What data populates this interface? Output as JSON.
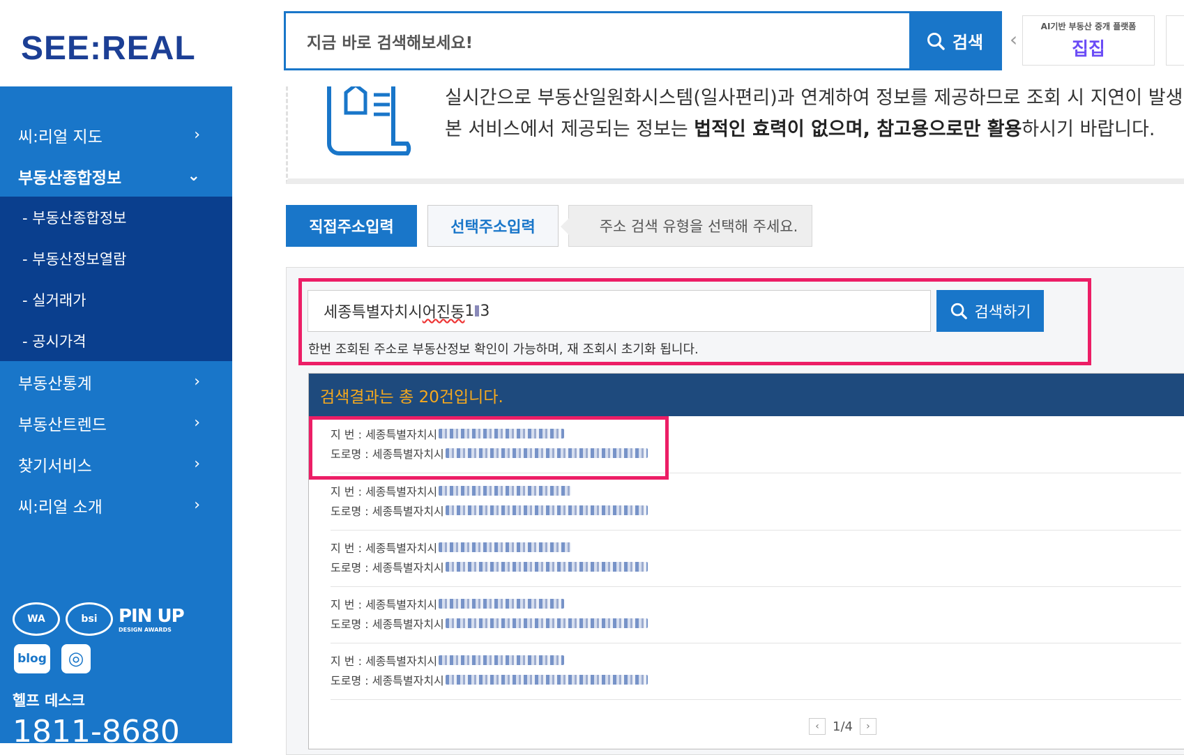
{
  "header": {
    "logo_left": "SEE",
    "logo_colon": ":",
    "logo_right": "REAL",
    "search_placeholder": "지금 바로 검색해보세요!",
    "search_button": "검색",
    "banner_small": "AI기반 부동산 중개 플랫폼",
    "banner_brand": "집집"
  },
  "sidebar": {
    "items": [
      {
        "label": "씨:리얼 지도"
      },
      {
        "label": "부동산종합정보"
      },
      {
        "label": "부동산통계"
      },
      {
        "label": "부동산트렌드"
      },
      {
        "label": "찾기서비스"
      },
      {
        "label": "씨:리얼 소개"
      }
    ],
    "submenu": [
      {
        "label": "- 부동산종합정보"
      },
      {
        "label": "- 부동산정보열람"
      },
      {
        "label": "- 실거래가"
      },
      {
        "label": "- 공시가격"
      }
    ],
    "pinup": "PIN UP",
    "pinup_sub": "DESIGN AWARDS",
    "blog": "blog",
    "help_label": "헬프 데스크",
    "help_phone": "1811-8680"
  },
  "notice": {
    "line1": "실시간으로 부동산일원화시스템(일사편리)과 연계하여 정보를 제공하므로 조회 시 지연이 발생",
    "line2_a": "본 서비스에서 제공되는 정보는 ",
    "line2_b": "법적인 효력이 없으며, 참고용으로만 활용",
    "line2_c": "하시기 바랍니다."
  },
  "tabs": {
    "direct": "직접주소입력",
    "select": "선택주소입력",
    "hint": "주소 검색 유형을 선택해 주세요."
  },
  "address_search": {
    "value_a": "세종특별자치시 ",
    "value_b": "어진동",
    "value_c": " 1",
    "value_d": "3",
    "button": "검색하기",
    "note": "한번 조회된 주소로 부동산정보 확인이 가능하며, 재 조회시 초기화 됩니다."
  },
  "results": {
    "header": "검색결과는 총 20건입니다.",
    "jibun_label": "지   번 : 세종특별자치시",
    "road_label": "도로명 : 세종특별자치시",
    "pagination": "1/4",
    "prev": "‹",
    "next": "›"
  },
  "colors": {
    "primary": "#1976c9",
    "sidebar_sub": "#0a3f8e",
    "highlight": "#ec1e66",
    "result_header_bg": "#1e4a7d",
    "result_header_text": "#f6a91d",
    "logo": "#1c3f95"
  }
}
